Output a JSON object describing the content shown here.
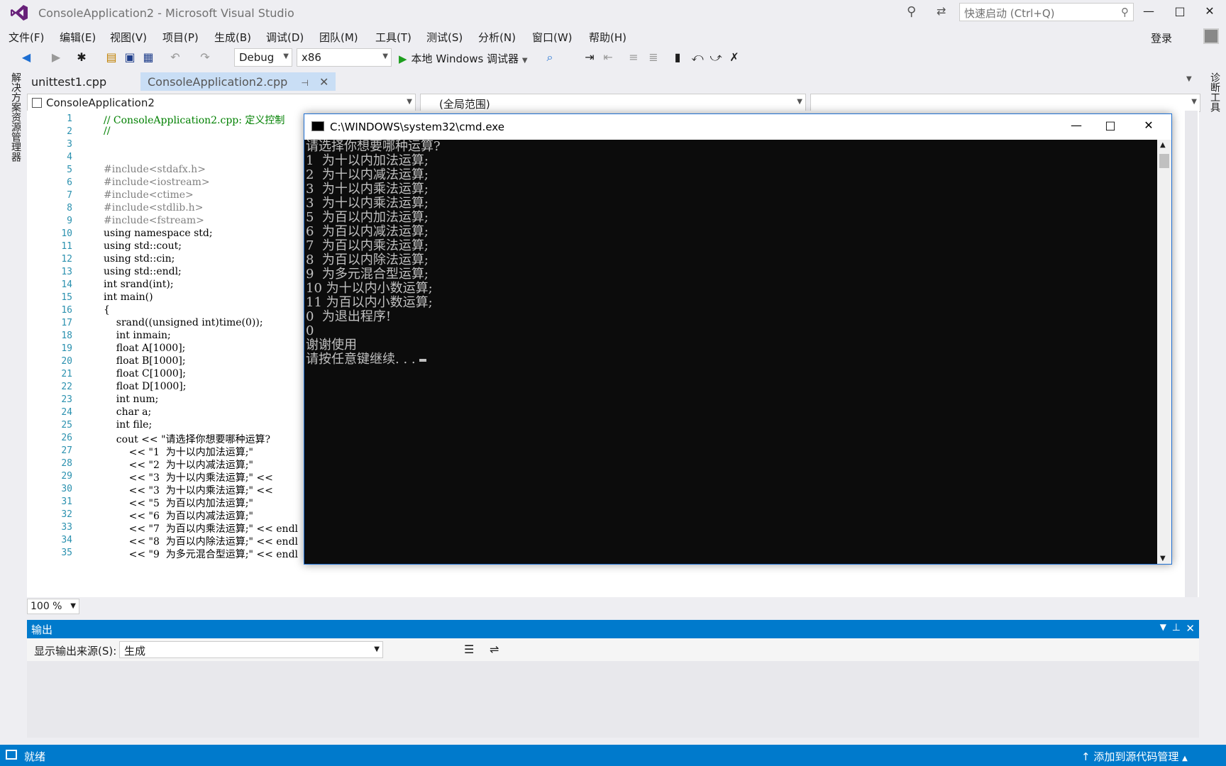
{
  "window": {
    "title": "ConsoleApplication2 - Microsoft Visual Studio",
    "quick_launch_placeholder": "快速启动 (Ctrl+Q)",
    "minimize": "—",
    "maximize": "□",
    "close": "✕"
  },
  "menu": [
    "文件(F)",
    "编辑(E)",
    "视图(V)",
    "项目(P)",
    "生成(B)",
    "调试(D)",
    "团队(M)",
    "工具(T)",
    "测试(S)",
    "分析(N)",
    "窗口(W)",
    "帮助(H)"
  ],
  "signin": "登录",
  "toolbar": {
    "config": "Debug",
    "platform": "x86",
    "run_label": "本地 Windows 调试器"
  },
  "left_rail": "解决方案资源管理器",
  "right_rail": "诊断工具",
  "tabs": [
    {
      "label": "unittest1.cpp"
    },
    {
      "label": "ConsoleApplication2.cpp"
    }
  ],
  "nav": {
    "project": "ConsoleApplication2",
    "scope": "(全局范围)"
  },
  "code_lines": [
    {
      "n": "1",
      "t": "// ConsoleApplication2.cpp: 定义控制"
    },
    {
      "n": "2",
      "t": "//"
    },
    {
      "n": "3",
      "t": ""
    },
    {
      "n": "4",
      "t": ""
    },
    {
      "n": "5",
      "t": "#include<stdafx.h>"
    },
    {
      "n": "6",
      "t": "#include<iostream>"
    },
    {
      "n": "7",
      "t": "#include<ctime>"
    },
    {
      "n": "8",
      "t": "#include<stdlib.h>"
    },
    {
      "n": "9",
      "t": "#include<fstream>"
    },
    {
      "n": "10",
      "t": "using namespace std;"
    },
    {
      "n": "11",
      "t": "using std::cout;"
    },
    {
      "n": "12",
      "t": "using std::cin;"
    },
    {
      "n": "13",
      "t": "using std::endl;"
    },
    {
      "n": "14",
      "t": "int srand(int);"
    },
    {
      "n": "15",
      "t": "int main()"
    },
    {
      "n": "16",
      "t": "{"
    },
    {
      "n": "17",
      "t": "    srand((unsigned int)time(0));"
    },
    {
      "n": "18",
      "t": "    int inmain;"
    },
    {
      "n": "19",
      "t": "    float A[1000];"
    },
    {
      "n": "20",
      "t": "    float B[1000];"
    },
    {
      "n": "21",
      "t": "    float C[1000];"
    },
    {
      "n": "22",
      "t": "    float D[1000];"
    },
    {
      "n": "23",
      "t": "    int num;"
    },
    {
      "n": "24",
      "t": "    char a;"
    },
    {
      "n": "25",
      "t": "    int file;"
    },
    {
      "n": "26",
      "t": "    cout << \"请选择你想要哪种运算?"
    },
    {
      "n": "27",
      "t": "        << \"1  为十以内加法运算;\""
    },
    {
      "n": "28",
      "t": "        << \"2  为十以内减法运算;\""
    },
    {
      "n": "29",
      "t": "        << \"3  为十以内乘法运算;\" <<"
    },
    {
      "n": "30",
      "t": "        << \"3  为十以内乘法运算;\" <<"
    },
    {
      "n": "31",
      "t": "        << \"5  为百以内加法运算;\""
    },
    {
      "n": "32",
      "t": "        << \"6  为百以内减法运算;\""
    },
    {
      "n": "33",
      "t": "        << \"7  为百以内乘法运算;\" << endl"
    },
    {
      "n": "34",
      "t": "        << \"8  为百以内除法运算;\" << endl"
    },
    {
      "n": "35",
      "t": "        << \"9  为多元混合型运算;\" << endl"
    }
  ],
  "zoom": "100 %",
  "cmd": {
    "title": "C:\\WINDOWS\\system32\\cmd.exe",
    "output": "请选择你想要哪种运算?\n1  为十以内加法运算;\n2  为十以内减法运算;\n3  为十以内乘法运算;\n3  为十以内乘法运算;\n5  为百以内加法运算;\n6  为百以内减法运算;\n7  为百以内乘法运算;\n8  为百以内除法运算;\n9  为多元混合型运算;\n10 为十以内小数运算;\n11 为百以内小数运算;\n0  为退出程序!\n0\n谢谢使用\n请按任意键继续. . . "
  },
  "output_panel": {
    "title": "输出",
    "source_label": "显示输出来源(S):",
    "source_value": "生成"
  },
  "status": {
    "text": "就绪",
    "right": "添加到源代码管理"
  }
}
